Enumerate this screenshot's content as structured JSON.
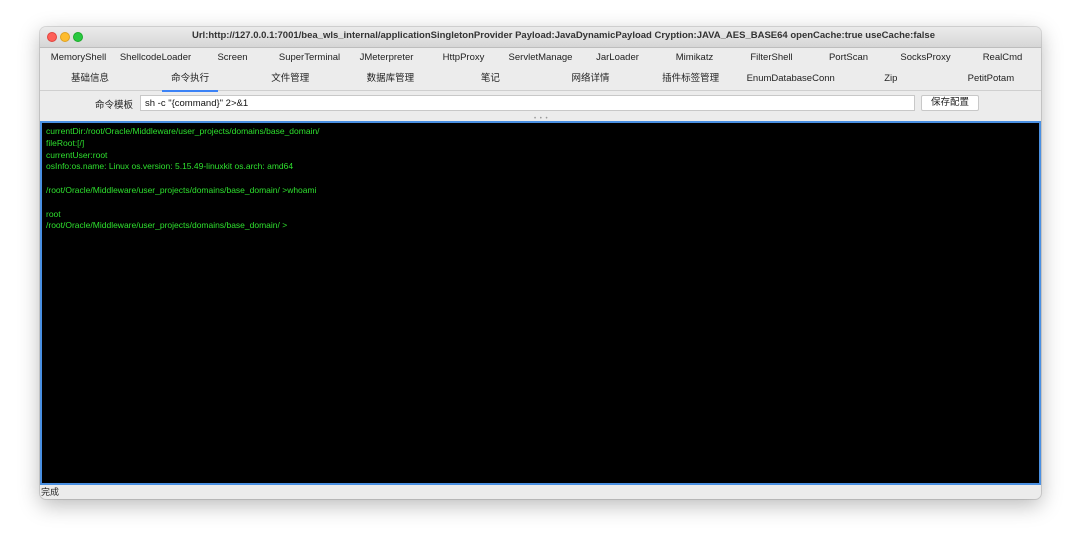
{
  "window": {
    "title": "Url:http://127.0.0.1:7001/bea_wls_internal/applicationSingletonProvider Payload:JavaDynamicPayload Cryption:JAVA_AES_BASE64 openCache:true useCache:false"
  },
  "plugin_tabs": [
    {
      "label": "MemoryShell"
    },
    {
      "label": "ShellcodeLoader"
    },
    {
      "label": "Screen"
    },
    {
      "label": "SuperTerminal"
    },
    {
      "label": "JMeterpreter"
    },
    {
      "label": "HttpProxy"
    },
    {
      "label": "ServletManage"
    },
    {
      "label": "JarLoader"
    },
    {
      "label": "Mimikatz"
    },
    {
      "label": "FilterShell"
    },
    {
      "label": "PortScan"
    },
    {
      "label": "SocksProxy"
    },
    {
      "label": "RealCmd"
    }
  ],
  "main_tabs": [
    {
      "label": "基础信息"
    },
    {
      "label": "命令执行",
      "active": true
    },
    {
      "label": "文件管理"
    },
    {
      "label": "数据库管理"
    },
    {
      "label": "笔记"
    },
    {
      "label": "网络详情"
    },
    {
      "label": "插件标签管理"
    },
    {
      "label": "EnumDatabaseConn"
    },
    {
      "label": "Zip"
    },
    {
      "label": "PetitPotam"
    }
  ],
  "command": {
    "label": "命令模板",
    "value": "sh -c \"{command}\" 2>&1",
    "save_label": "保存配置"
  },
  "terminal": {
    "text_color": "#2ee02e",
    "background": "#000000",
    "lines": [
      "currentDir:/root/Oracle/Middleware/user_projects/domains/base_domain/",
      "fileRoot:[/]",
      "currentUser:root",
      "osInfo:os.name: Linux os.version: 5.15.49-linuxkit os.arch: amd64",
      "",
      "/root/Oracle/Middleware/user_projects/domains/base_domain/ >whoami",
      "",
      "root",
      "/root/Oracle/Middleware/user_projects/domains/base_domain/ >"
    ]
  },
  "status": {
    "text": "完成"
  }
}
